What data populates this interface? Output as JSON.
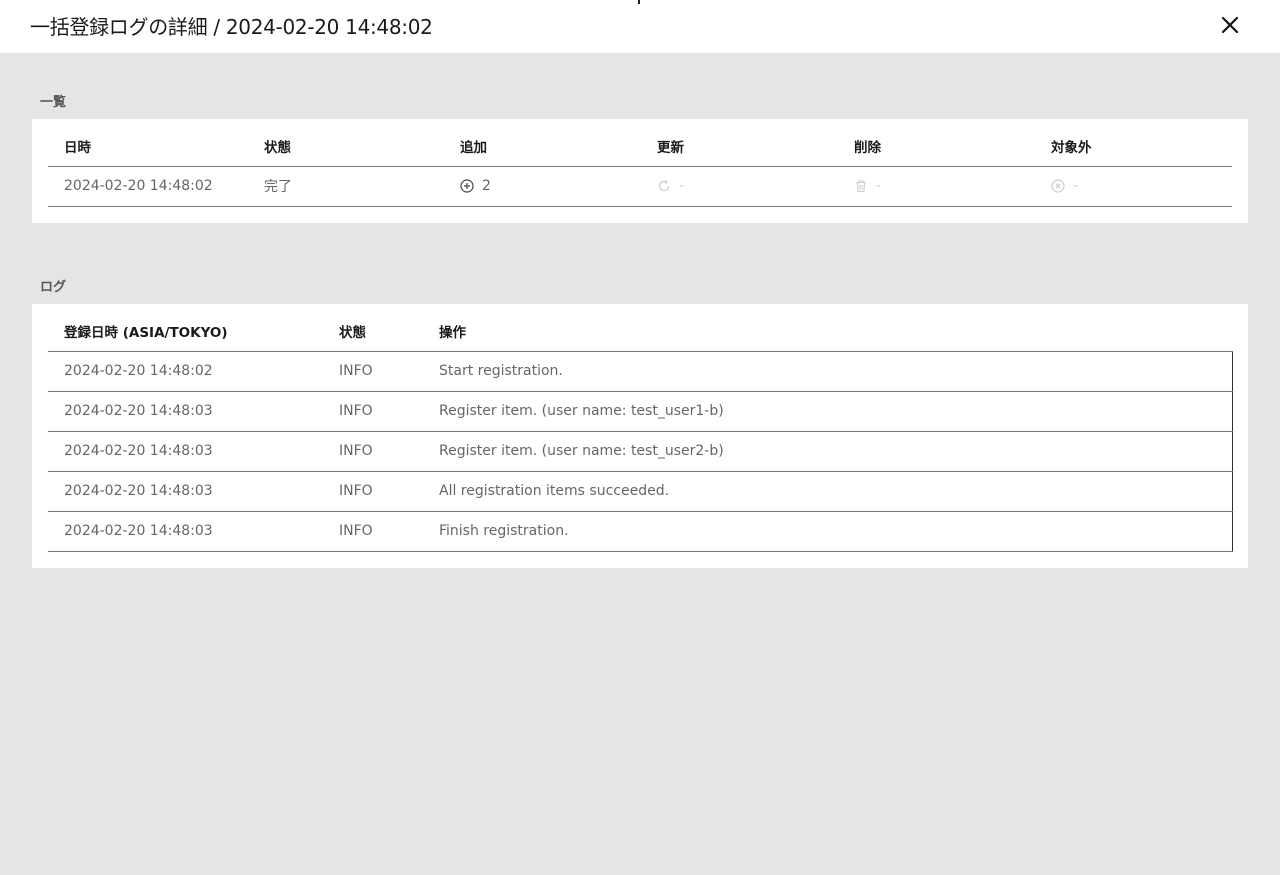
{
  "header": {
    "title": "一括登録ログの詳細 / 2024-02-20 14:48:02",
    "close_icon": "close-icon"
  },
  "summary": {
    "section_label": "一覧",
    "columns": [
      "日時",
      "状態",
      "追加",
      "更新",
      "削除",
      "対象外"
    ],
    "row": {
      "datetime": "2024-02-20 14:48:02",
      "status": "完了",
      "added": "2",
      "updated": "-",
      "deleted": "-",
      "excluded": "-"
    },
    "icons": {
      "added": "plus-circle-icon",
      "updated": "refresh-icon",
      "deleted": "trash-icon",
      "excluded": "x-circle-icon"
    }
  },
  "log": {
    "section_label": "ログ",
    "columns": [
      "登録日時 (ASIA/TOKYO)",
      "状態",
      "操作"
    ],
    "rows": [
      {
        "datetime": "2024-02-20 14:48:02",
        "status": "INFO",
        "operation": "Start registration."
      },
      {
        "datetime": "2024-02-20 14:48:03",
        "status": "INFO",
        "operation": "Register item. (user name: test_user1-b)"
      },
      {
        "datetime": "2024-02-20 14:48:03",
        "status": "INFO",
        "operation": "Register item. (user name: test_user2-b)"
      },
      {
        "datetime": "2024-02-20 14:48:03",
        "status": "INFO",
        "operation": "All registration items succeeded."
      },
      {
        "datetime": "2024-02-20 14:48:03",
        "status": "INFO",
        "operation": "Finish registration."
      }
    ]
  },
  "colors": {
    "background": "#e5e5e5",
    "panel": "#ffffff",
    "muted_icon": "#cccccc"
  }
}
